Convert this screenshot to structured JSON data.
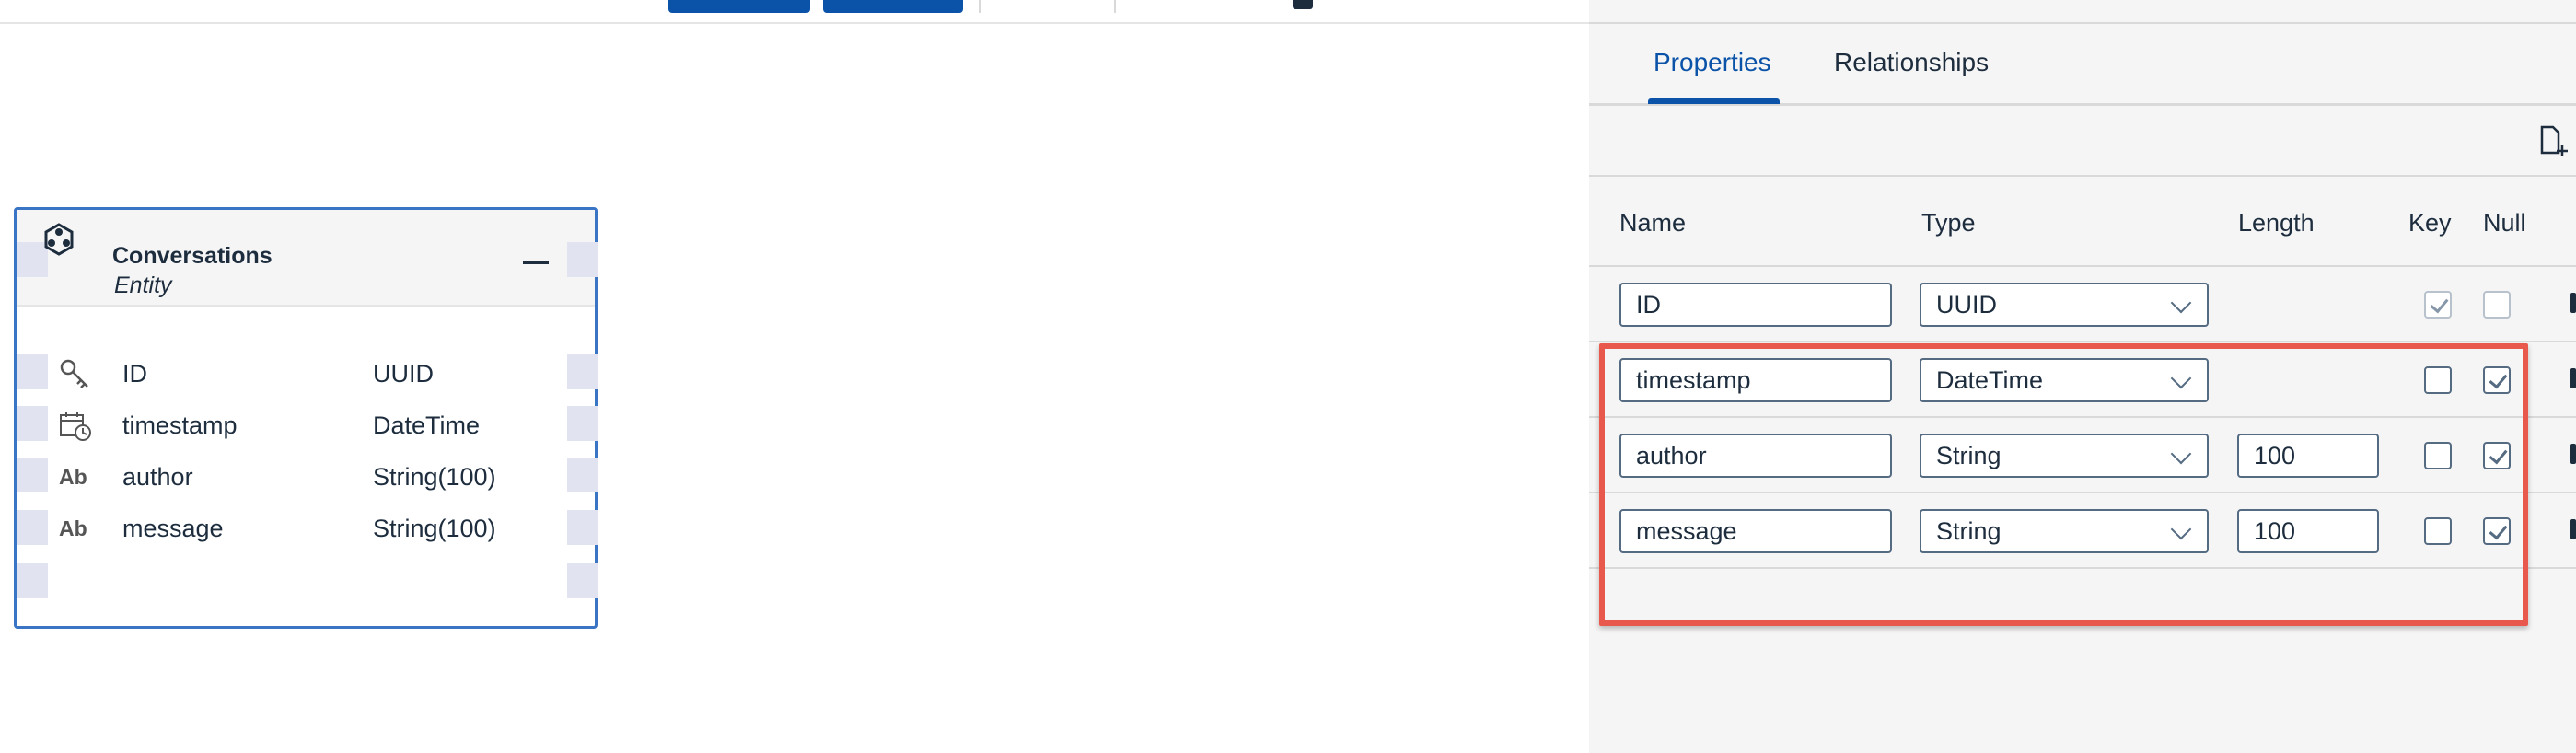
{
  "entity": {
    "title": "Conversations",
    "subtitle": "Entity",
    "attributes": [
      {
        "icon": "key-icon",
        "name": "ID",
        "type": "UUID"
      },
      {
        "icon": "calendar-clock-icon",
        "name": "timestamp",
        "type": "DateTime"
      },
      {
        "icon": "Ab",
        "name": "author",
        "type": "String(100)"
      },
      {
        "icon": "Ab",
        "name": "message",
        "type": "String(100)"
      }
    ]
  },
  "panel": {
    "tabs": [
      {
        "label": "Properties",
        "active": true
      },
      {
        "label": "Relationships",
        "active": false
      }
    ],
    "columns": [
      "Name",
      "Type",
      "Length",
      "Key",
      "Null"
    ],
    "rows": [
      {
        "name": "ID",
        "type": "UUID",
        "length": "",
        "key": true,
        "null": false,
        "key_disabled": true,
        "null_disabled": true
      },
      {
        "name": "timestamp",
        "type": "DateTime",
        "length": "",
        "key": false,
        "null": true
      },
      {
        "name": "author",
        "type": "String",
        "length": "100",
        "key": false,
        "null": true
      },
      {
        "name": "message",
        "type": "String",
        "length": "100",
        "key": false,
        "null": true
      }
    ]
  },
  "colors": {
    "accent": "#0a53a8",
    "entity_border": "#3a74c5",
    "highlight": "#e8584d",
    "port": "#e2e3f1"
  }
}
